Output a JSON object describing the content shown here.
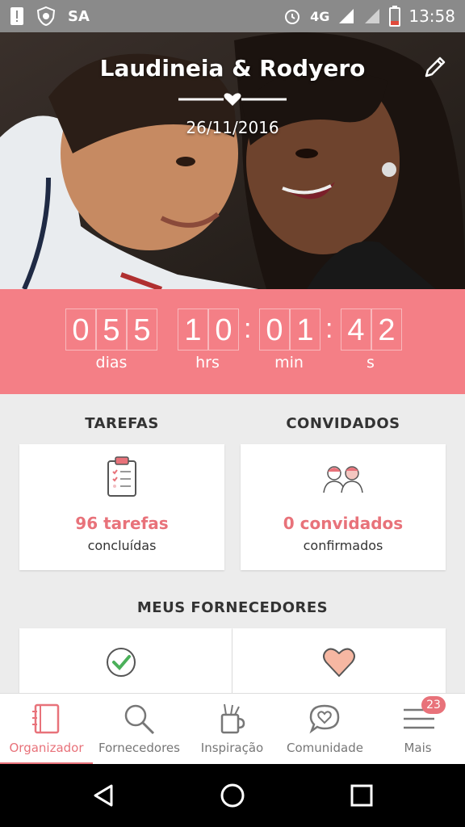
{
  "status_bar": {
    "carrier": "SA",
    "network": "4G",
    "time": "13:58"
  },
  "hero": {
    "couple_names": "Laudineia & Rodyero",
    "date": "26/11/2016"
  },
  "countdown": {
    "days_digits": [
      "0",
      "5",
      "5"
    ],
    "hours_digits": [
      "1",
      "0"
    ],
    "minutes_digits": [
      "0",
      "1"
    ],
    "seconds_digits": [
      "4",
      "2"
    ],
    "units": {
      "days": "dias",
      "hours": "hrs",
      "minutes": "min",
      "seconds": "s"
    }
  },
  "tasks": {
    "title": "TAREFAS",
    "count": "96 tarefas",
    "sub": "concluídas"
  },
  "guests": {
    "title": "CONVIDADOS",
    "count": "0 convidados",
    "sub": "confirmados"
  },
  "vendors": {
    "title": "MEUS FORNECEDORES"
  },
  "nav": {
    "items": [
      {
        "label": "Organizador"
      },
      {
        "label": "Fornecedores"
      },
      {
        "label": "Inspiração"
      },
      {
        "label": "Comunidade"
      },
      {
        "label": "Mais"
      }
    ],
    "badge": "23"
  },
  "colors": {
    "accent": "#e8727a",
    "countdown_bg": "#f47f86"
  }
}
